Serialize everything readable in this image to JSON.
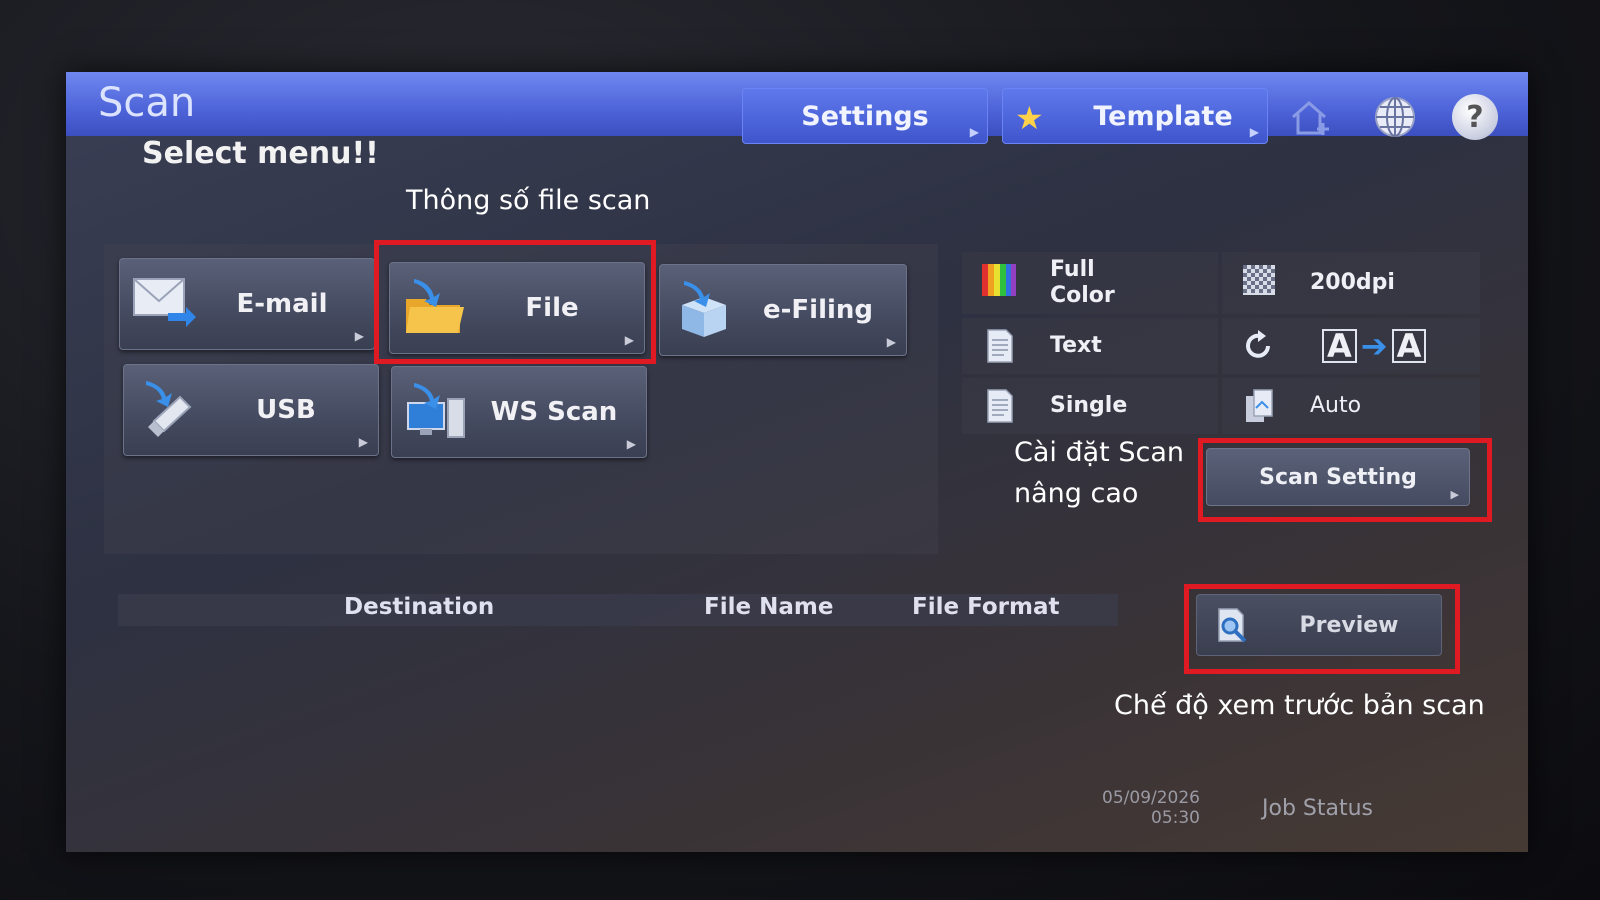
{
  "header": {
    "title": "Scan",
    "tabs": [
      {
        "label": "Settings"
      },
      {
        "label": "Template"
      }
    ],
    "icons": [
      "home-add-icon",
      "globe-icon",
      "help-icon"
    ],
    "help_glyph": "?"
  },
  "main": {
    "prompt": "Select menu!!",
    "functions": [
      {
        "label": "E-mail",
        "icon": "email-icon"
      },
      {
        "label": "File",
        "icon": "folder-icon"
      },
      {
        "label": "e-Filing",
        "icon": "box-icon"
      },
      {
        "label": "USB",
        "icon": "usb-icon"
      },
      {
        "label": "WS Scan",
        "icon": "computer-icon"
      }
    ]
  },
  "scan_settings": {
    "color_mode_line1": "Full",
    "color_mode_line2": "Color",
    "resolution": "200dpi",
    "original_mode": "Text",
    "rotation_label_from": "A",
    "rotation_label_to": "A",
    "duplex": "Single",
    "size": "Auto",
    "scan_setting_button": "Scan Setting"
  },
  "preview": {
    "label": "Preview"
  },
  "destination_table": {
    "columns": [
      "Destination",
      "File Name",
      "File Format"
    ]
  },
  "footer": {
    "date": "05/09/2026",
    "time": "05:30",
    "job_status": "Job Status"
  },
  "annotations": {
    "file": "Thông số file scan",
    "scan_setting": "Cài đặt Scan nâng cao",
    "preview": "Chế độ xem trước bản scan"
  },
  "colors": {
    "topbar": "#4d63d8",
    "highlight": "#e01a22",
    "star": "#ffd24a"
  }
}
